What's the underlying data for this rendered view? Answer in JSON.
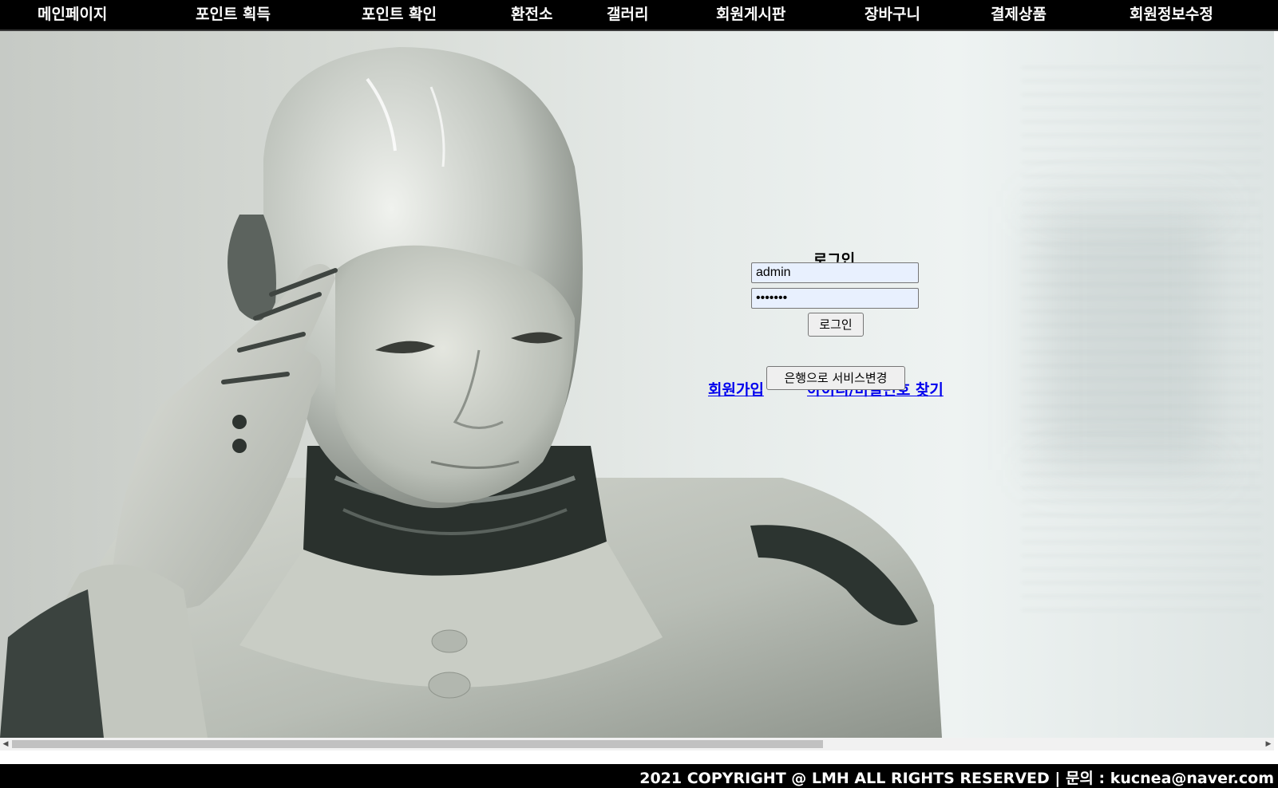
{
  "nav": {
    "items": [
      {
        "label": "메인페이지"
      },
      {
        "label": "포인트 획득"
      },
      {
        "label": "포인트 확인"
      },
      {
        "label": "환전소"
      },
      {
        "label": "갤러리"
      },
      {
        "label": "회원게시판"
      },
      {
        "label": "장바구니"
      },
      {
        "label": "결제상품"
      },
      {
        "label": "회원정보수정"
      }
    ]
  },
  "login": {
    "title": "로그인",
    "username_value": "admin",
    "password_value": "1234567",
    "submit_label": "로그인",
    "signup_link": "회원가입",
    "find_link": "아이디/비밀번호 찾기",
    "switch_service_label": "은행으로 서비스변경"
  },
  "scrollbar": {
    "left_arrow": "◀",
    "right_arrow": "▶",
    "thumb_fraction": 0.65
  },
  "footer": {
    "text": "2021 COPYRIGHT @ LMH ALL RIGHTS RESERVED | 문의 : kucnea@naver.com"
  },
  "colors": {
    "nav_bg": "#000000",
    "nav_text": "#ffffff",
    "link": "#0000ee",
    "input_bg": "#e8f0fe"
  }
}
